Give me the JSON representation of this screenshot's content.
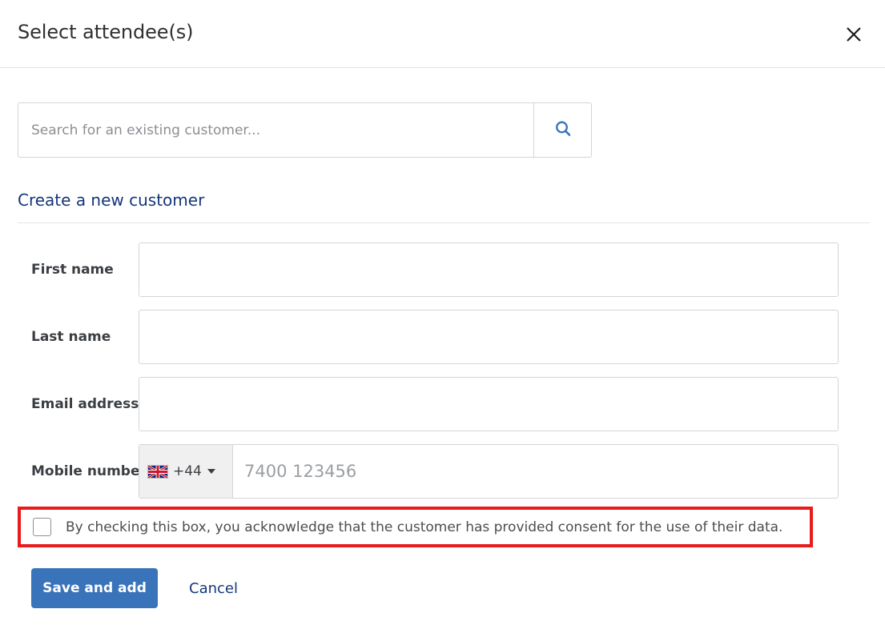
{
  "header": {
    "title": "Select attendee(s)",
    "close_icon": "close-icon"
  },
  "search": {
    "placeholder": "Search for an existing customer...",
    "value": "",
    "button_icon": "search-icon",
    "icon_color": "#3973b9"
  },
  "section": {
    "create_link": "Create a new customer"
  },
  "form": {
    "fields": [
      {
        "label": "First name",
        "value": "",
        "placeholder": ""
      },
      {
        "label": "Last name",
        "value": "",
        "placeholder": ""
      },
      {
        "label": "Email address",
        "value": "",
        "placeholder": ""
      }
    ],
    "phone": {
      "label": "Mobile number",
      "flag": "uk-flag-icon",
      "dial_code": "+44",
      "caret_icon": "chevron-down-icon",
      "placeholder": "7400 123456",
      "value": ""
    }
  },
  "consent": {
    "checked": false,
    "text": "By checking this box, you acknowledge that the customer has provided consent for the use of their data.",
    "highlight_color": "#e81c1c"
  },
  "footer": {
    "save_label": "Save and add",
    "cancel_label": "Cancel",
    "save_color": "#3973b9",
    "cancel_color": "#14367a"
  }
}
